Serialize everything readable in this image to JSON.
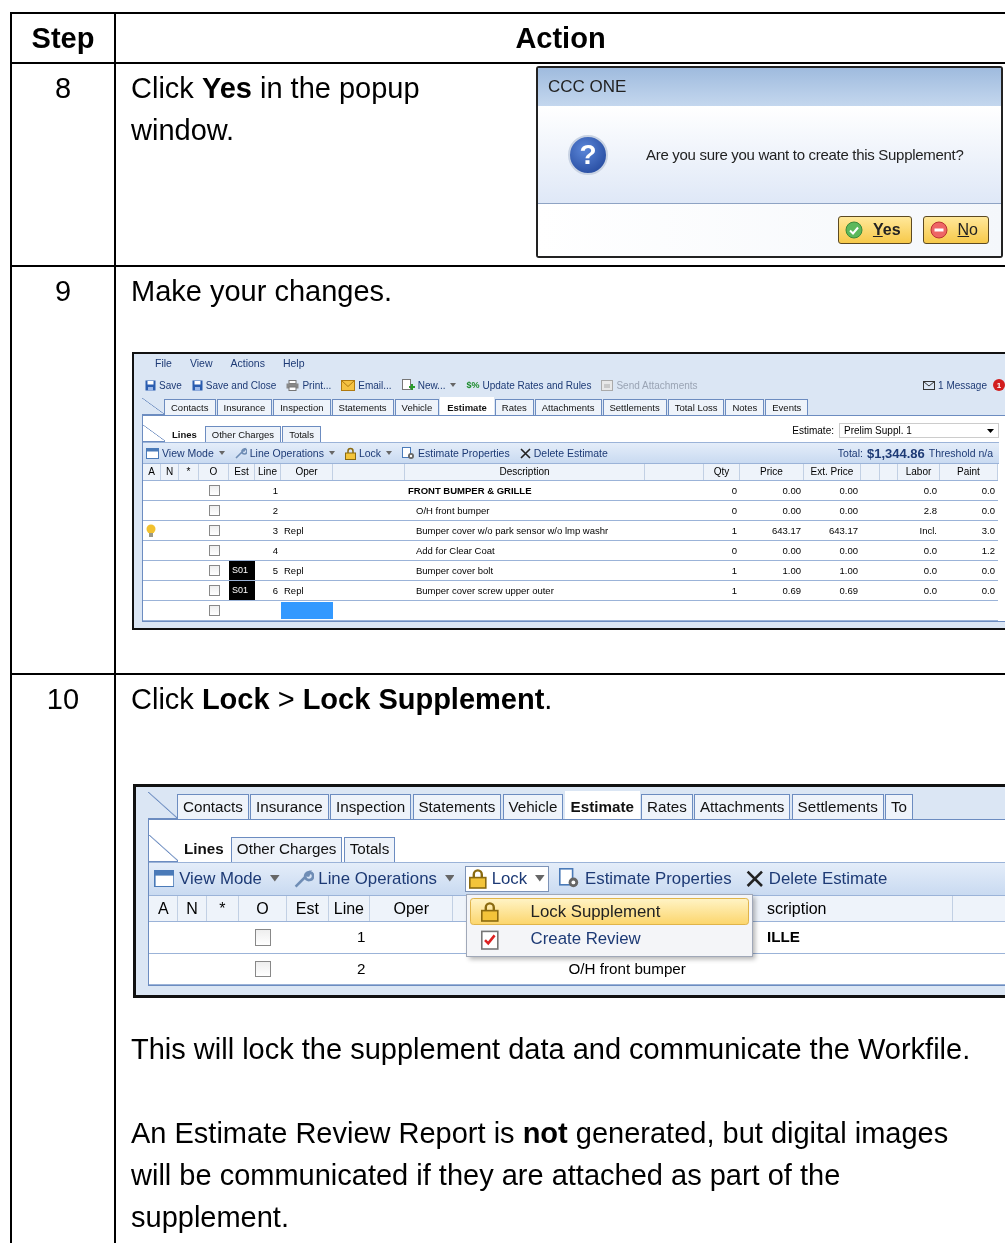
{
  "table": {
    "columns": [
      "Step",
      "Action"
    ],
    "rows": [
      {
        "step": "8",
        "kind": "dialog",
        "text": "Click **Yes** in the popup window.",
        "dialog": {
          "title": "CCC ONE",
          "icon": "?",
          "message": "Are you sure you want to create this Supplement?",
          "buttons": [
            {
              "label": "Yes",
              "kind": "confirm",
              "default": true
            },
            {
              "label": "No",
              "kind": "cancel",
              "default": false
            }
          ]
        }
      },
      {
        "step": "9",
        "kind": "estimate",
        "text": "Make your changes.",
        "screen": {
          "menu": [
            "File",
            "View",
            "Actions",
            "Help"
          ],
          "toolbar": [
            {
              "label": "Save",
              "kind": "save",
              "disabled": false,
              "dropdown": false
            },
            {
              "label": "Save and Close",
              "kind": "save",
              "disabled": false,
              "dropdown": false
            },
            {
              "label": "Print...",
              "kind": "print",
              "disabled": false,
              "dropdown": false
            },
            {
              "label": "Email...",
              "kind": "email",
              "disabled": false,
              "dropdown": false
            },
            {
              "label": "New...",
              "kind": "new",
              "disabled": false,
              "dropdown": true
            },
            {
              "label": "Update Rates and Rules",
              "kind": "rates",
              "glyph": "$%",
              "disabled": false,
              "dropdown": false
            },
            {
              "label": "Send Attachments",
              "kind": "send",
              "disabled": true,
              "dropdown": false
            }
          ],
          "messages": {
            "label": "1 Message",
            "count": "1"
          },
          "tabs": [
            {
              "label": "Contacts",
              "selected": false
            },
            {
              "label": "Insurance",
              "selected": false
            },
            {
              "label": "Inspection",
              "selected": false
            },
            {
              "label": "Statements",
              "selected": false
            },
            {
              "label": "Vehicle",
              "selected": false
            },
            {
              "label": "Estimate",
              "selected": true
            },
            {
              "label": "Rates",
              "selected": false
            },
            {
              "label": "Attachments",
              "selected": false
            },
            {
              "label": "Settlements",
              "selected": false
            },
            {
              "label": "Total Loss",
              "selected": false
            },
            {
              "label": "Notes",
              "selected": false
            },
            {
              "label": "Events",
              "selected": false
            }
          ],
          "subtabs": [
            {
              "label": "Lines",
              "selected": true
            },
            {
              "label": "Other Charges",
              "selected": false
            },
            {
              "label": "Totals",
              "selected": false
            }
          ],
          "estimate_selector": {
            "label": "Estimate:",
            "value": "Prelim Suppl.  1"
          },
          "actions": [
            {
              "label": "View Mode",
              "kind": "view",
              "dropdown": true,
              "open": false
            },
            {
              "label": "Line Operations",
              "kind": "wrench",
              "dropdown": true,
              "open": false
            },
            {
              "label": "Lock",
              "kind": "lock",
              "dropdown": true,
              "open": false
            },
            {
              "label": "Estimate Properties",
              "kind": "properties",
              "dropdown": false,
              "open": false
            },
            {
              "label": "Delete Estimate",
              "kind": "delete",
              "dropdown": false,
              "open": false
            }
          ],
          "total": {
            "label": "Total:",
            "value": "$1,344.86",
            "threshold": "Threshold n/a"
          },
          "columns": [
            "A",
            "N",
            "*",
            "O",
            "Est",
            "Line",
            "Oper",
            "Description",
            "Qty",
            "Price",
            "Ext. Price",
            "Labor",
            "Paint"
          ],
          "rows": [
            {
              "hint": false,
              "checked": false,
              "line": "1",
              "description": "FRONT BUMPER & GRILLE",
              "heading": true,
              "qty": "0",
              "price": "0.00",
              "ext_price": "0.00",
              "labor": "0.0",
              "paint": "0.0",
              "selected": false
            },
            {
              "hint": false,
              "checked": false,
              "line": "2",
              "description": "O/H front bumper",
              "heading": false,
              "qty": "0",
              "price": "0.00",
              "ext_price": "0.00",
              "labor": "2.8",
              "paint": "0.0",
              "selected": false
            },
            {
              "hint": true,
              "checked": false,
              "line": "3",
              "oper": "Repl",
              "description": "Bumper cover w/o park sensor w/o lmp washr",
              "heading": false,
              "qty": "1",
              "price": "643.17",
              "ext_price": "643.17",
              "labor": "Incl.",
              "paint": "3.0",
              "selected": false
            },
            {
              "hint": false,
              "checked": false,
              "line": "4",
              "description": "Add for Clear Coat",
              "heading": false,
              "qty": "0",
              "price": "0.00",
              "ext_price": "0.00",
              "labor": "0.0",
              "paint": "1.2",
              "selected": false
            },
            {
              "hint": false,
              "checked": false,
              "est": "S01",
              "line": "5",
              "oper": "Repl",
              "description": "Bumper cover bolt",
              "heading": false,
              "qty": "1",
              "price": "1.00",
              "ext_price": "1.00",
              "labor": "0.0",
              "paint": "0.0",
              "selected": false
            },
            {
              "hint": false,
              "checked": false,
              "est": "S01",
              "line": "6",
              "oper": "Repl",
              "description": "Bumper cover screw upper outer",
              "heading": false,
              "qty": "1",
              "price": "0.69",
              "ext_price": "0.69",
              "labor": "0.0",
              "paint": "0.0",
              "selected": false
            },
            {
              "hint": false,
              "checked": false,
              "selected": true
            }
          ]
        }
      },
      {
        "step": "10",
        "kind": "lock_menu",
        "text": "Click **Lock** > **Lock Supplement**.",
        "screen": {
          "tabs": [
            {
              "label": "Contacts",
              "selected": false
            },
            {
              "label": "Insurance",
              "selected": false
            },
            {
              "label": "Inspection",
              "selected": false
            },
            {
              "label": "Statements",
              "selected": false
            },
            {
              "label": "Vehicle",
              "selected": false
            },
            {
              "label": "Estimate",
              "selected": true
            },
            {
              "label": "Rates",
              "selected": false
            },
            {
              "label": "Attachments",
              "selected": false
            },
            {
              "label": "Settlements",
              "selected": false
            },
            {
              "label": "To",
              "selected": false
            }
          ],
          "subtabs": [
            {
              "label": "Lines",
              "selected": true
            },
            {
              "label": "Other Charges",
              "selected": false
            },
            {
              "label": "Totals",
              "selected": false
            }
          ],
          "actions": [
            {
              "label": "View Mode",
              "kind": "view",
              "dropdown": true,
              "open": false
            },
            {
              "label": "Line Operations",
              "kind": "wrench",
              "dropdown": true,
              "open": false
            },
            {
              "label": "Lock",
              "kind": "lock",
              "dropdown": true,
              "open": true
            },
            {
              "label": "Estimate Properties",
              "kind": "properties",
              "dropdown": false,
              "open": false
            },
            {
              "label": "Delete Estimate",
              "kind": "delete",
              "dropdown": false,
              "open": false
            }
          ],
          "columns": [
            "A",
            "N",
            "*",
            "O",
            "Est",
            "Line",
            "Oper",
            "scription"
          ],
          "rows": [
            {
              "hint": false,
              "checked": false,
              "line": "1",
              "description": "ILLE",
              "heading": true,
              "selected": false
            },
            {
              "hint": false,
              "checked": false,
              "line": "2",
              "description": "O/H front bumper",
              "heading": false,
              "selected": false
            }
          ],
          "dropdown_menu": [
            {
              "label": "Lock Supplement",
              "kind": "lock",
              "selected": true
            },
            {
              "label": "Create Review",
              "kind": "review",
              "selected": false
            }
          ]
        },
        "notes": [
          "This will lock the supplement data and communicate the Workfile.",
          "An Estimate Review Report is **not** generated, but digital images will be communicated if they are attached as part of the supplement."
        ]
      }
    ]
  }
}
